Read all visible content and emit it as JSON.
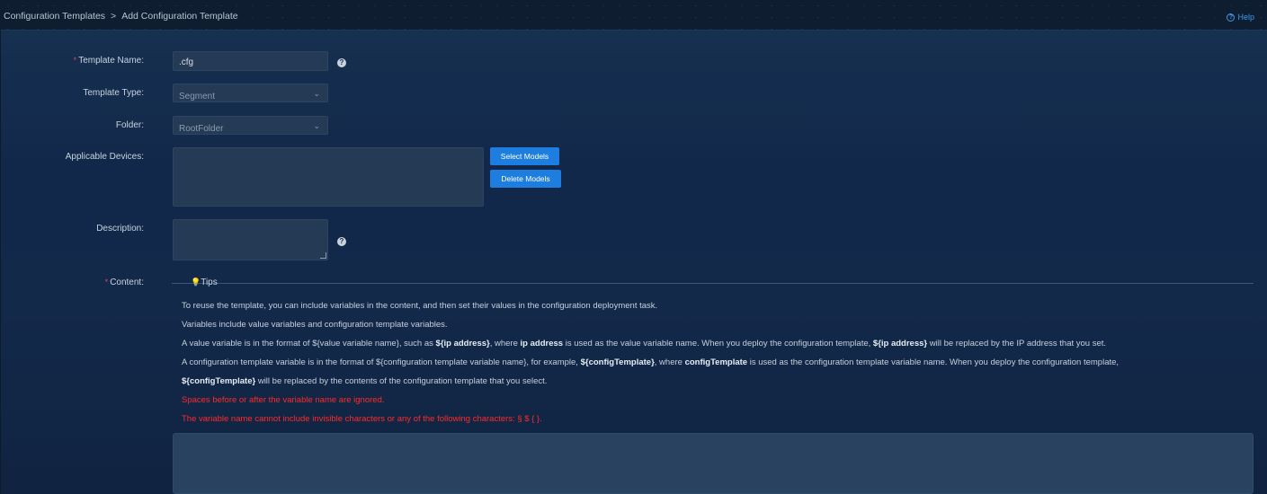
{
  "breadcrumb": {
    "parent": "Configuration Templates",
    "separator": ">",
    "current": "Add Configuration Template"
  },
  "help": {
    "label": "Help",
    "icon": "help-circle-icon"
  },
  "form": {
    "template_name": {
      "label": "Template Name:",
      "value": ".cfg",
      "required": true
    },
    "template_type": {
      "label": "Template Type:",
      "value": "Segment"
    },
    "folder": {
      "label": "Folder:",
      "value": "RootFolder"
    },
    "applicable_devices": {
      "label": "Applicable Devices:",
      "select_button": "Select Models",
      "delete_button": "Delete Models"
    },
    "description": {
      "label": "Description:",
      "value": ""
    },
    "content": {
      "label": "Content:",
      "required": true,
      "value": ""
    }
  },
  "tips": {
    "title": "Tips",
    "line1": "To reuse the template, you can include variables in the content, and then set their values in the configuration deployment task.",
    "line2": "Variables include value variables and configuration template variables.",
    "line3": {
      "a": "A value variable is in the format of ${value variable name}, such as ",
      "b": "${ip address}",
      "c": ", where ",
      "d": "ip address",
      "e": " is used as the value variable name. When you deploy the configuration template, ",
      "f": "${ip address}",
      "g": " will be replaced by the IP address that you set."
    },
    "line4": {
      "a": "A configuration template variable is in the format of ${configuration template variable name}, for example, ",
      "b": "${configTemplate}",
      "c": ", where ",
      "d": "configTemplate",
      "e": " is used as the configuration template variable name. When you deploy the configuration template,"
    },
    "line5": {
      "a": "${configTemplate}",
      "b": " will be replaced by the contents of the configuration template that you select."
    },
    "warn1": "Spaces before or after the variable name are ignored.",
    "warn2": "The variable name cannot include invisible characters or any of the following characters: § $ { }."
  },
  "colors": {
    "accent": "#1e7ee0",
    "required": "#e8434c",
    "warning": "#ff2a2a",
    "panel": "#13294a"
  }
}
